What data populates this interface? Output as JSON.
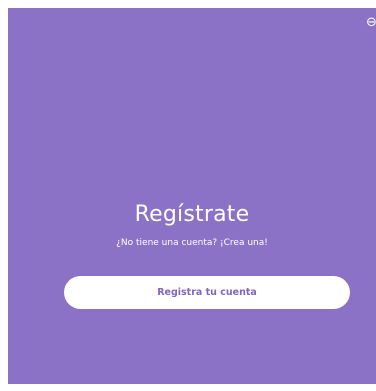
{
  "register_panel": {
    "title": "Regístrate",
    "subtitle": "¿No tiene una cuenta? ¡Crea una!",
    "button_label": "Registra tu cuenta",
    "background_color": "#8b72c7",
    "text_color": "#ffffff",
    "button_text_color": "#8066bf",
    "corner_icon": "partial-icon-at-edge"
  }
}
